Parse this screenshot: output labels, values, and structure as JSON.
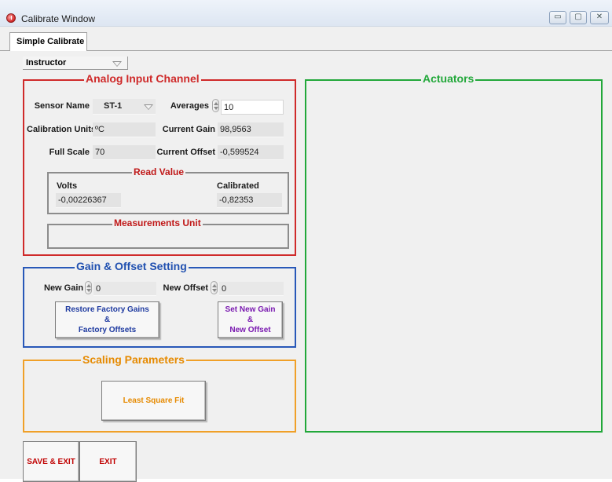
{
  "window": {
    "title": "Calibrate Window",
    "controls": {
      "minimize": "▭",
      "maximize": "▢",
      "close": "✕"
    }
  },
  "tabs": [
    {
      "label": "Simple Calibrate"
    }
  ],
  "role_dropdown": {
    "value": "Instructor"
  },
  "analog_input": {
    "title": "Analog Input Channel",
    "sensor_name_label": "Sensor Name",
    "sensor_name_value": "ST-1",
    "averages_label": "Averages",
    "averages_value": "10",
    "calibration_units_label": "Calibration Units",
    "calibration_units_value": "ºC",
    "current_gain_label": "Current Gain",
    "current_gain_value": "98,9563",
    "full_scale_label": "Full Scale",
    "full_scale_value": "70",
    "current_offset_label": "Current Offset",
    "current_offset_value": "-0,599524",
    "read_value": {
      "title": "Read Value",
      "volts_label": "Volts",
      "volts_value": "-0,00226367",
      "calibrated_label": "Calibrated",
      "calibrated_value": "-0,82353"
    },
    "measurements_unit": {
      "title": "Measurements Unit",
      "value": ""
    }
  },
  "gain_offset": {
    "title": "Gain & Offset Setting",
    "new_gain_label": "New Gain",
    "new_gain_value": "0",
    "new_offset_label": "New Offset",
    "new_offset_value": "0",
    "restore_button": [
      "Restore  Factory Gains",
      "&",
      "Factory Offsets"
    ],
    "set_button": [
      "Set  New Gain",
      "&",
      "New Offset"
    ]
  },
  "scaling": {
    "title": "Scaling Parameters",
    "least_square_button": "Least Square Fit"
  },
  "actuators": {
    "title": "Actuators"
  },
  "footer": {
    "save_exit": "SAVE & EXIT",
    "exit": "EXIT"
  },
  "colors": {
    "analog_border": "#cf2a2a",
    "gain_border": "#2858b8",
    "scaling_border": "#f0a028",
    "actuators_border": "#22a83a",
    "save_exit_text": "#c00000",
    "restore_text": "#1e3aa0",
    "set_text": "#7a1ab0",
    "least_square_text": "#e68a00"
  }
}
